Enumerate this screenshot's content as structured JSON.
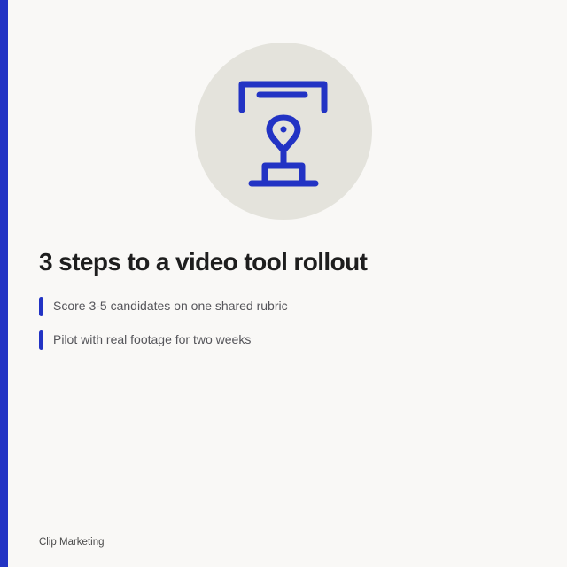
{
  "slide": {
    "title": "3 steps to a video tool rollout",
    "steps": [
      {
        "text": "Score 3-5 candidates on one shared rubric"
      },
      {
        "text": "Pilot with real footage for two weeks"
      }
    ],
    "footer": "Clip Marketing"
  },
  "hero": {
    "icon": "stand-icon"
  },
  "colors": {
    "accent": "#2233c4",
    "circle": "#e4e3dc",
    "background": "#f9f8f6",
    "title": "#1e1e1e",
    "body_text": "#55555a"
  }
}
